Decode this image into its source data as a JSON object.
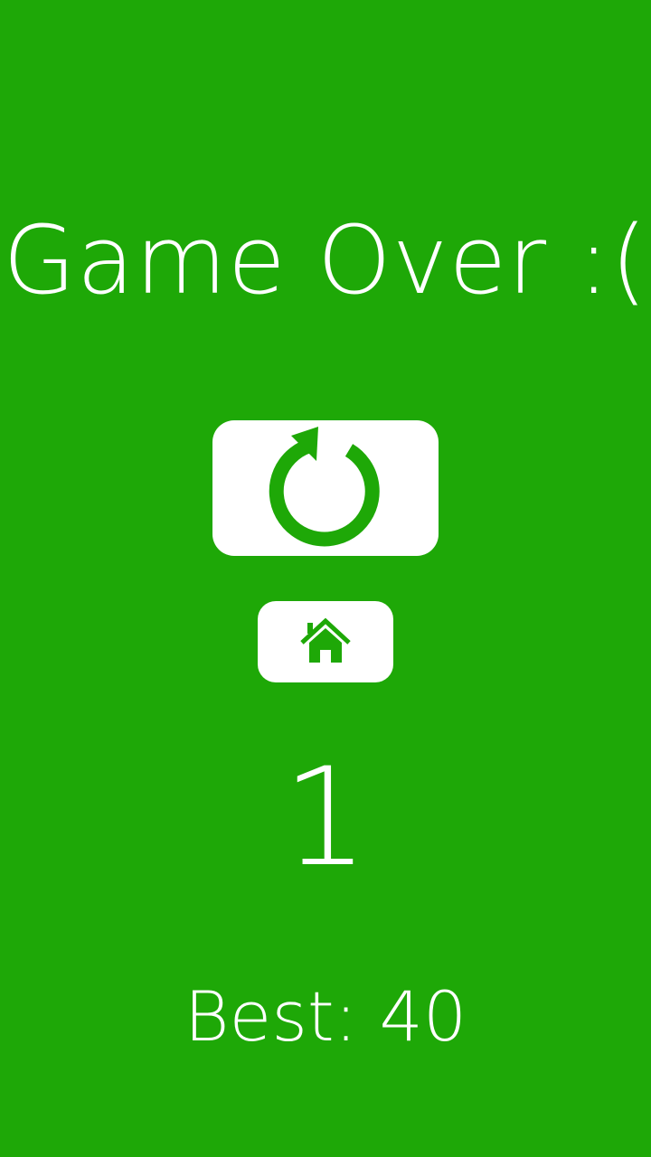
{
  "screen": {
    "background_color": "#1ea807",
    "title": "Game Over :(",
    "score": "1",
    "best_label": "Best: 40"
  },
  "buttons": {
    "restart_icon": "restart-icon",
    "home_icon": "home-icon",
    "icon_color": "#1ea807"
  }
}
